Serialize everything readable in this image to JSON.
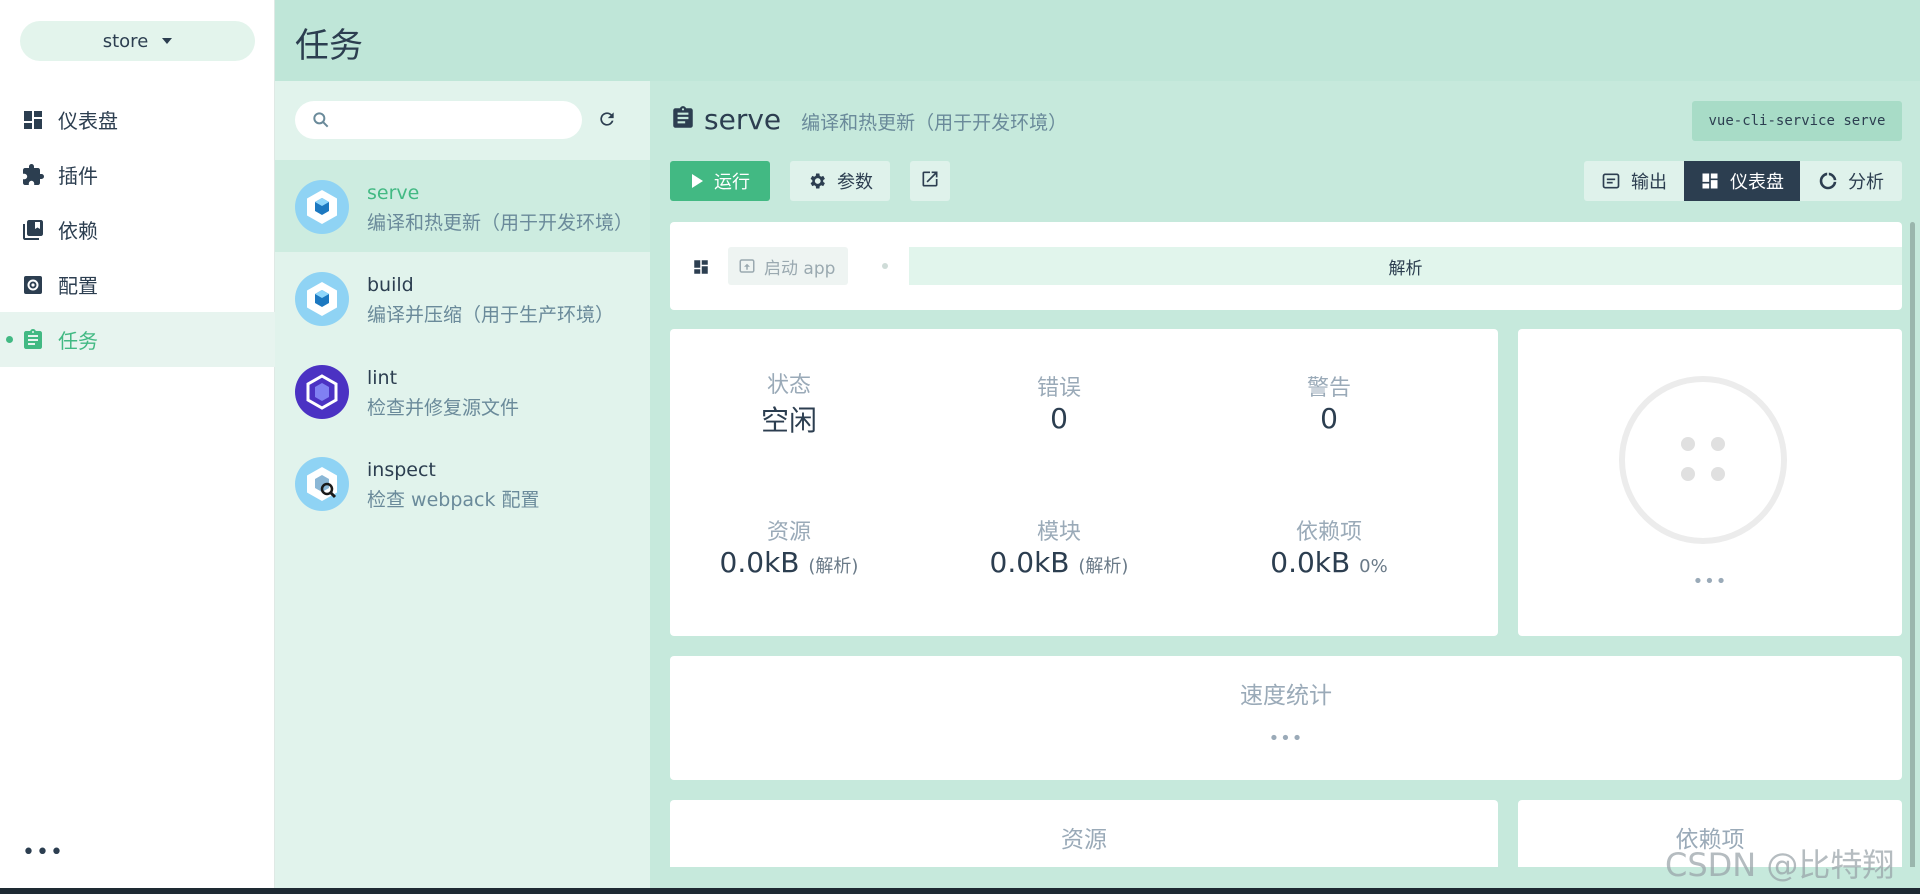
{
  "nav": {
    "project": "store",
    "items": [
      {
        "label": "仪表盘",
        "icon": "dashboard-icon"
      },
      {
        "label": "插件",
        "icon": "puzzle-icon"
      },
      {
        "label": "依赖",
        "icon": "library-icon"
      },
      {
        "label": "配置",
        "icon": "settings-icon"
      },
      {
        "label": "任务",
        "icon": "clipboard-icon",
        "active": true
      }
    ],
    "more": "•••"
  },
  "header": {
    "title": "任务"
  },
  "tasks": {
    "search": {
      "placeholder": "",
      "value": ""
    },
    "list": [
      {
        "name": "serve",
        "desc": "编译和热更新（用于开发环境）",
        "selected": true
      },
      {
        "name": "build",
        "desc": "编译并压缩（用于生产环境）"
      },
      {
        "name": "lint",
        "desc": "检查并修复源文件"
      },
      {
        "name": "inspect",
        "desc": "检查 webpack 配置"
      }
    ]
  },
  "main": {
    "task_name": "serve",
    "task_desc": "编译和热更新（用于开发环境）",
    "command": "vue-cli-service serve",
    "run_label": "运行",
    "params_label": "参数",
    "views": {
      "output": "输出",
      "dashboard": "仪表盘",
      "analyze": "分析"
    },
    "toolbar": {
      "launch_app": "启动 app",
      "progress_label": "解析"
    },
    "status": {
      "state_label": "状态",
      "state_value": "空闲",
      "errors_label": "错误",
      "errors_value": "0",
      "warnings_label": "警告",
      "warnings_value": "0",
      "assets_label": "资源",
      "assets_value": "0.0kB",
      "assets_note": "(解析)",
      "modules_label": "模块",
      "modules_value": "0.0kB",
      "modules_note": "(解析)",
      "deps_label": "依赖项",
      "deps_value": "0.0kB",
      "deps_note": "0%"
    },
    "chart_more": "•••",
    "speed_title": "速度统计",
    "speed_more": "•••",
    "assets_title": "资源",
    "deps_title": "依赖项"
  },
  "watermark": "CSDN @比特翔",
  "colors": {
    "accent": "#42b983",
    "dark": "#2c3e50",
    "header": "#bfe6d8",
    "panel": "#e1f3ec",
    "main": "#c6e9dc"
  }
}
